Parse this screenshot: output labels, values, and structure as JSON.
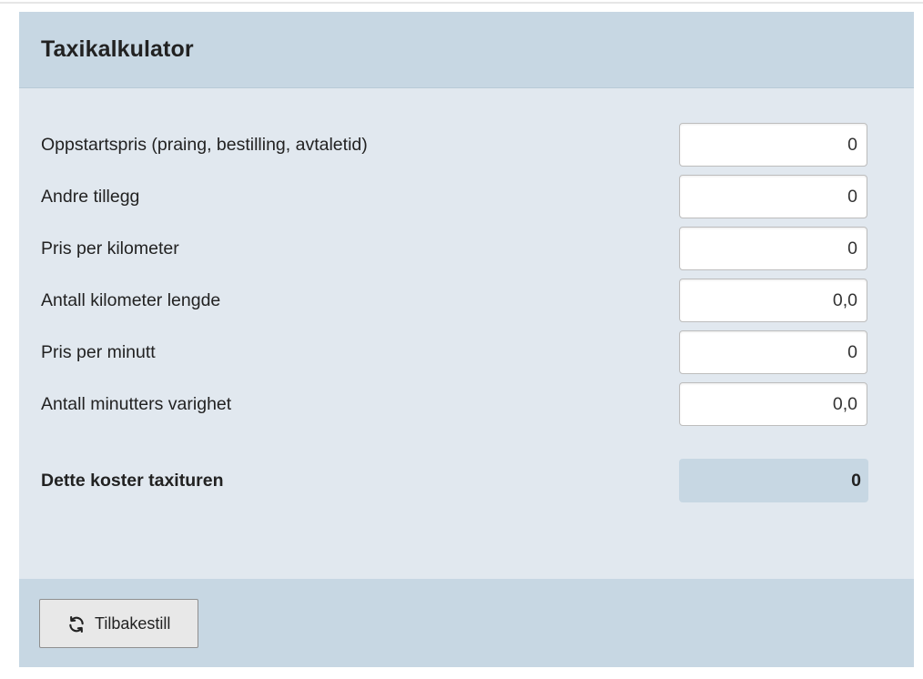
{
  "panel": {
    "title": "Taxikalkulator"
  },
  "fields": [
    {
      "label": "Oppstartspris (praing, bestilling, avtaletid)",
      "value": "0"
    },
    {
      "label": "Andre tillegg",
      "value": "0"
    },
    {
      "label": "Pris per kilometer",
      "value": "0"
    },
    {
      "label": "Antall kilometer lengde",
      "value": "0,0"
    },
    {
      "label": "Pris per minutt",
      "value": "0"
    },
    {
      "label": "Antall minutters varighet",
      "value": "0,0"
    }
  ],
  "total": {
    "label": "Dette koster taxituren",
    "value": "0"
  },
  "footer": {
    "reset_label": "Tilbakestill",
    "reset_icon": "refresh-icon"
  },
  "colors": {
    "header_bg": "#c7d7e3",
    "body_bg": "#e1e8ef"
  }
}
